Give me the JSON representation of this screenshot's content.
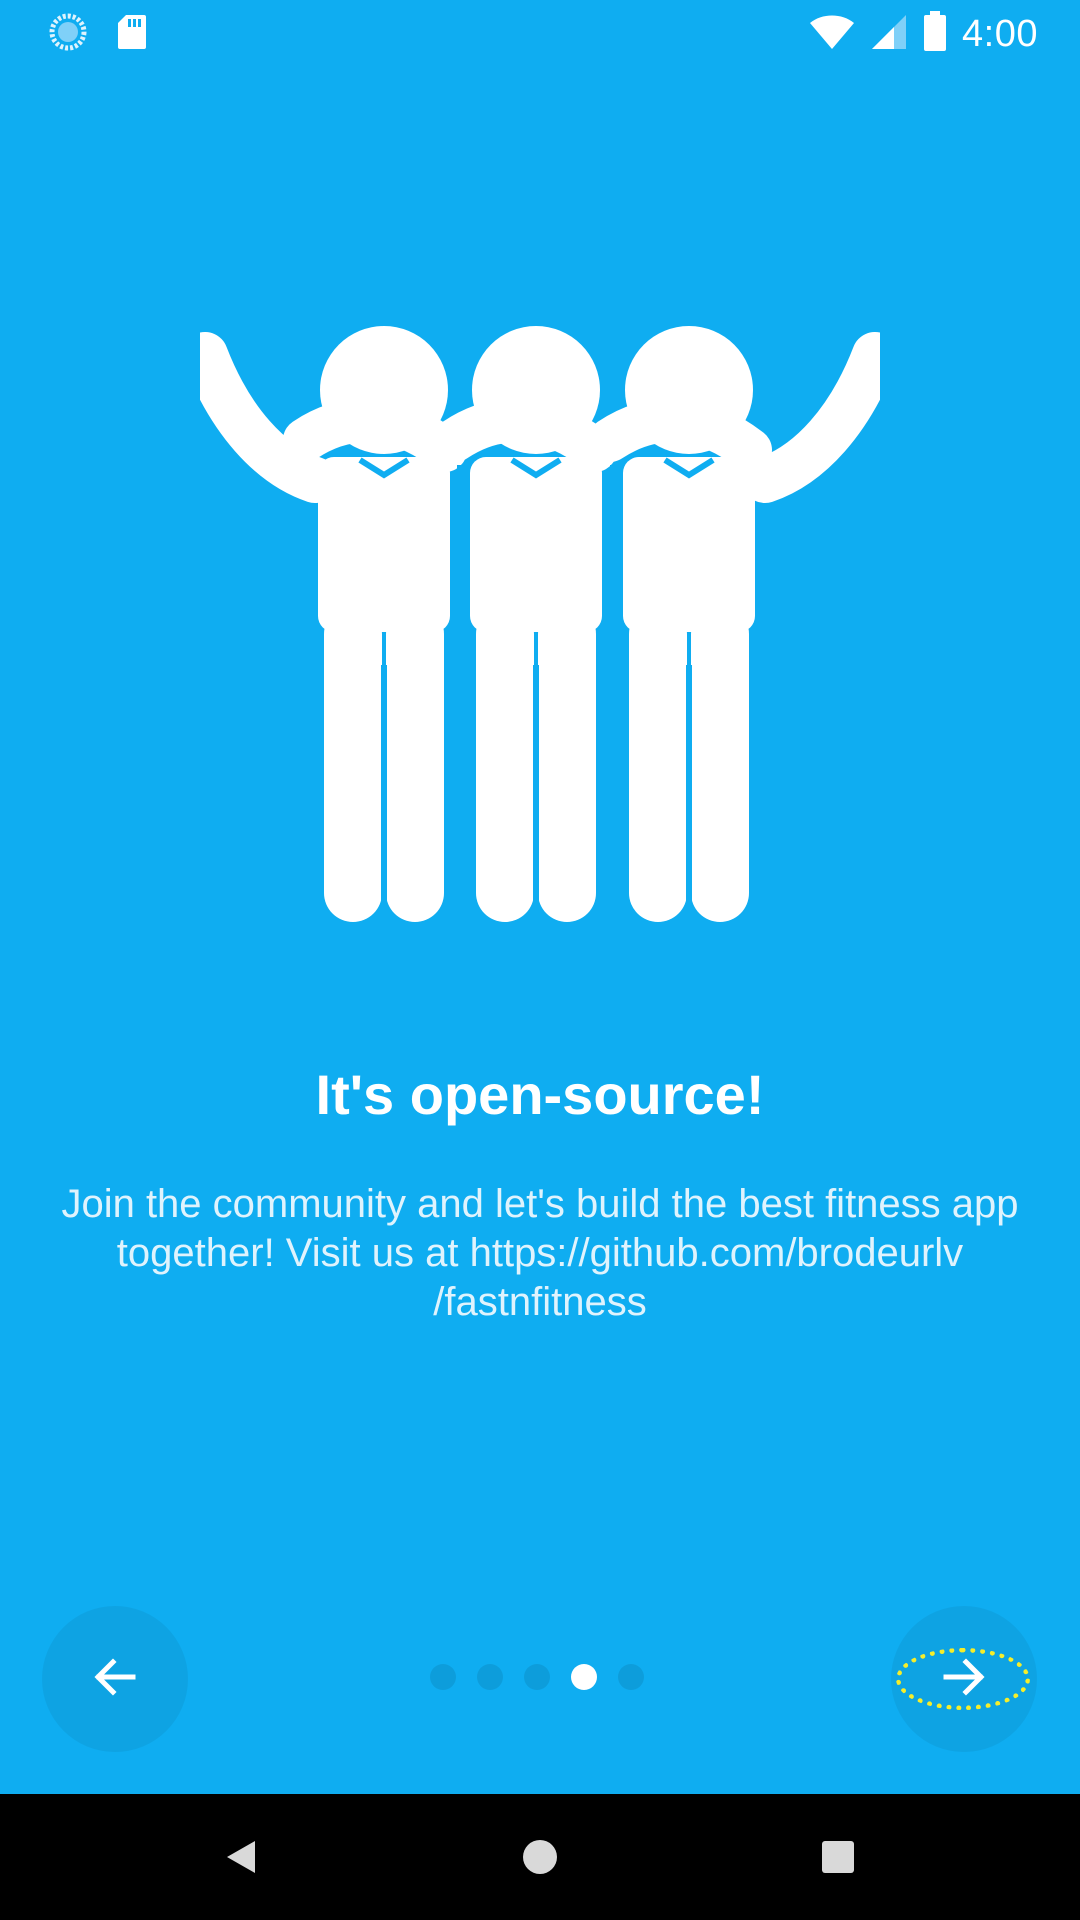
{
  "status_bar": {
    "time": "4:00",
    "icons": [
      "sync-icon",
      "sd-card-icon",
      "wifi-icon",
      "cell-signal-icon",
      "battery-icon"
    ]
  },
  "slide": {
    "illustration": "community-people-icon",
    "title": "It's open-source!",
    "description": "Join the community and let's build the best fitness app together! Visit us at https://github.com/brodeurlv /fastnfitness"
  },
  "pager": {
    "total": 5,
    "active_index": 3
  },
  "controls": {
    "back_icon": "arrow-left-icon",
    "next_icon": "arrow-right-icon"
  },
  "system_nav": {
    "icons": [
      "system-back-icon",
      "system-home-icon",
      "system-recents-icon"
    ]
  },
  "colors": {
    "background": "#0fadf1",
    "accent_focus": "#f6ee2a"
  }
}
